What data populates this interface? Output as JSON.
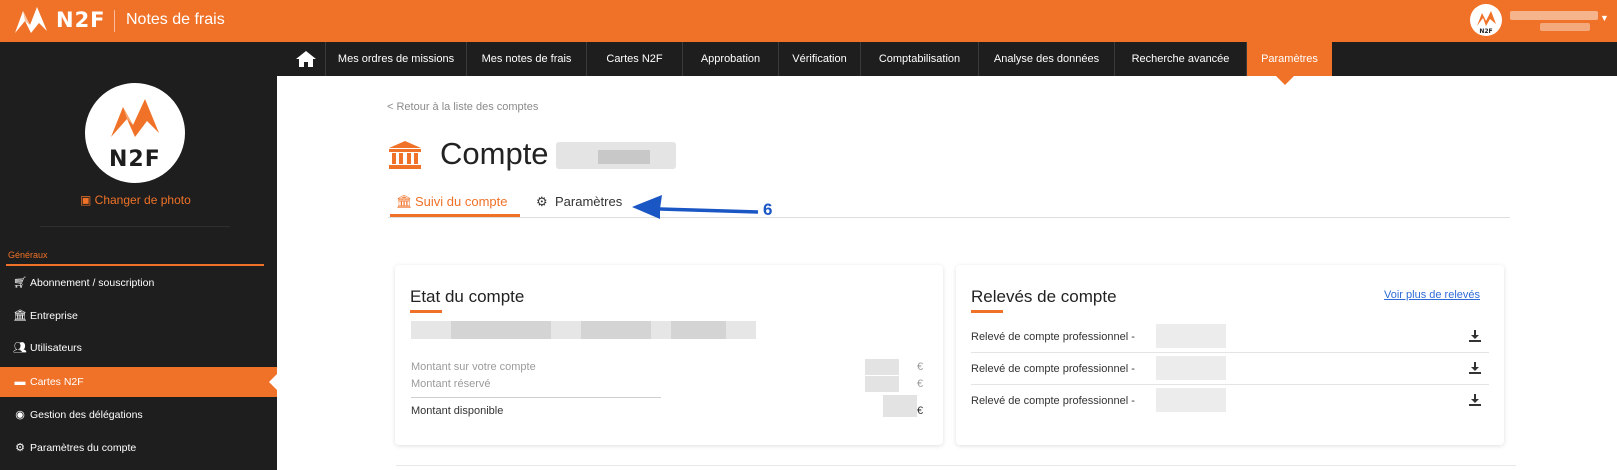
{
  "topbar": {
    "brand": "N2F",
    "app_title": "Notes de frais",
    "brand_color": "#f07228"
  },
  "nav": {
    "items": [
      {
        "label": "Mes ordres de missions"
      },
      {
        "label": "Mes notes de frais"
      },
      {
        "label": "Cartes N2F"
      },
      {
        "label": "Approbation"
      },
      {
        "label": "Vérification"
      },
      {
        "label": "Comptabilisation"
      },
      {
        "label": "Analyse des données"
      },
      {
        "label": "Recherche avancée"
      },
      {
        "label": "Paramètres",
        "active": true
      }
    ]
  },
  "sidebar": {
    "logo_text": "N2F",
    "change_photo": "Changer de photo",
    "section_title": "Généraux",
    "items": [
      {
        "label": "Abonnement / souscription",
        "icon": "cart-icon"
      },
      {
        "label": "Entreprise",
        "icon": "bank-icon"
      },
      {
        "label": "Utilisateurs",
        "icon": "users-icon"
      },
      {
        "label": "Cartes N2F",
        "icon": "credit-card-icon",
        "active": true
      },
      {
        "label": "Gestion des délégations",
        "icon": "eye-icon"
      },
      {
        "label": "Paramètres du compte",
        "icon": "gears-icon"
      }
    ]
  },
  "main": {
    "back_link": "< Retour à la liste des comptes",
    "title": "Compte",
    "tabs": [
      {
        "label": "Suivi du compte",
        "icon": "bank-icon",
        "active": true
      },
      {
        "label": "Paramètres",
        "icon": "gears-icon"
      }
    ],
    "annotation_number": "6",
    "annotation_color": "#1a56c4"
  },
  "account_card": {
    "title": "Etat du compte",
    "rows": [
      {
        "label": "Montant sur votre compte",
        "currency": "€"
      },
      {
        "label": "Montant réservé",
        "currency": "€"
      },
      {
        "label": "Montant disponible",
        "currency": "€"
      }
    ]
  },
  "statements_card": {
    "title": "Relevés de compte",
    "more_link": "Voir plus de relevés",
    "rows": [
      {
        "label": "Relevé de compte professionnel -"
      },
      {
        "label": "Relevé de compte professionnel -"
      },
      {
        "label": "Relevé de compte professionnel -"
      }
    ]
  }
}
